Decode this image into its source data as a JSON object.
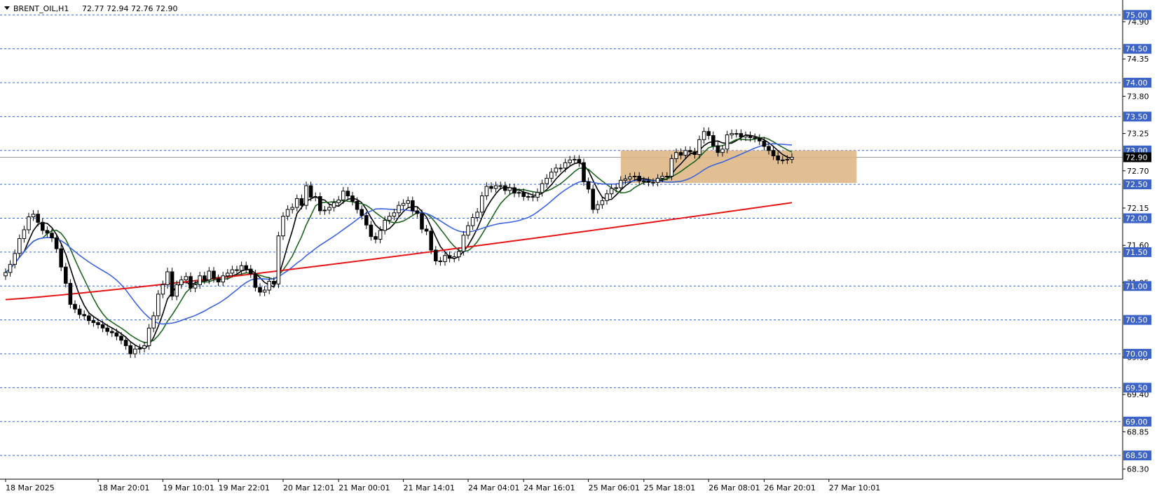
{
  "header": {
    "symbol": "BRENT_OIL,H1",
    "ohlc": "72.77 72.94 72.76 72.90"
  },
  "colors": {
    "background": "#ffffff",
    "level_line": "#3c64c8",
    "level_label_bg": "#3c64c8",
    "zone_fill": "#deb887",
    "ma_black": "#000000",
    "ma_green": "#1e641e",
    "ma_blue": "#3c64dc",
    "ma_red": "#e61414",
    "current_price_bg": "#000000"
  },
  "chart_data": {
    "type": "candlestick",
    "title": "BRENT_OIL,H1",
    "ylim": [
      68.15,
      75.22
    ],
    "y_ticks": [
      {
        "value": 74.9,
        "label": "74.90"
      },
      {
        "value": 74.35,
        "label": "74.35"
      },
      {
        "value": 73.8,
        "label": "73.80"
      },
      {
        "value": 73.25,
        "label": "73.25"
      },
      {
        "value": 72.7,
        "label": "72.70"
      },
      {
        "value": 72.15,
        "label": "72.15"
      },
      {
        "value": 71.6,
        "label": "71.60"
      },
      {
        "value": 71.05,
        "label": "71.05"
      },
      {
        "value": 69.95,
        "label": "69.95"
      },
      {
        "value": 69.4,
        "label": "69.40"
      },
      {
        "value": 68.85,
        "label": "68.85"
      },
      {
        "value": 68.3,
        "label": "68.30"
      }
    ],
    "x_ticks": [
      {
        "bar": 0,
        "label": "18 Mar 2025"
      },
      {
        "bar": 20,
        "label": "18 Mar 20:01"
      },
      {
        "bar": 34,
        "label": "19 Mar 10:01"
      },
      {
        "bar": 46,
        "label": "19 Mar 22:01"
      },
      {
        "bar": 60,
        "label": "20 Mar 12:01"
      },
      {
        "bar": 72,
        "label": "21 Mar 00:01"
      },
      {
        "bar": 86,
        "label": "21 Mar 14:01"
      },
      {
        "bar": 100,
        "label": "24 Mar 04:01"
      },
      {
        "bar": 112,
        "label": "24 Mar 16:01"
      },
      {
        "bar": 126,
        "label": "25 Mar 06:01"
      },
      {
        "bar": 138,
        "label": "25 Mar 18:01"
      },
      {
        "bar": 152,
        "label": "26 Mar 08:01"
      },
      {
        "bar": 164,
        "label": "26 Mar 20:01"
      },
      {
        "bar": 178,
        "label": "27 Mar 10:01"
      }
    ],
    "levels": [
      {
        "value": 75.0,
        "label": "75.00"
      },
      {
        "value": 74.5,
        "label": "74.50"
      },
      {
        "value": 74.0,
        "label": "74.00"
      },
      {
        "value": 73.5,
        "label": "73.50"
      },
      {
        "value": 73.0,
        "label": "73.00"
      },
      {
        "value": 72.5,
        "label": "72.50"
      },
      {
        "value": 72.0,
        "label": "72.00"
      },
      {
        "value": 71.5,
        "label": "71.50"
      },
      {
        "value": 71.0,
        "label": "71.00"
      },
      {
        "value": 70.5,
        "label": "70.50"
      },
      {
        "value": 70.0,
        "label": "70.00"
      },
      {
        "value": 69.5,
        "label": "69.50"
      },
      {
        "value": 69.0,
        "label": "69.00"
      },
      {
        "value": 68.5,
        "label": "68.50"
      }
    ],
    "current_price": {
      "value": 72.9,
      "label": "72.90"
    },
    "zone": {
      "bar_start": 133,
      "bar_end": 184,
      "y_low": 72.52,
      "y_high": 73.0
    },
    "bar_count": 190,
    "candles_close": [
      71.2,
      71.32,
      71.48,
      71.7,
      71.83,
      72.02,
      72.06,
      71.94,
      71.82,
      71.78,
      71.71,
      71.55,
      71.28,
      71.04,
      70.73,
      70.66,
      70.58,
      70.56,
      70.49,
      70.46,
      70.43,
      70.38,
      70.33,
      70.31,
      70.26,
      70.2,
      70.12,
      70.0,
      70.07,
      70.08,
      70.12,
      70.38,
      70.56,
      70.88,
      71.02,
      71.21,
      70.85,
      71.02,
      71.09,
      71.14,
      70.97,
      71.02,
      71.15,
      71.09,
      71.22,
      71.11,
      71.06,
      71.15,
      71.19,
      71.24,
      71.23,
      71.3,
      71.25,
      71.18,
      70.98,
      70.91,
      70.94,
      71.07,
      71.03,
      71.74,
      72.03,
      72.13,
      72.16,
      72.29,
      72.19,
      72.48,
      72.31,
      72.32,
      72.11,
      72.12,
      72.16,
      72.23,
      72.27,
      72.4,
      72.33,
      72.25,
      72.13,
      72.04,
      71.9,
      71.73,
      71.69,
      71.82,
      71.97,
      72.03,
      72.08,
      72.19,
      72.22,
      72.26,
      72.11,
      72.07,
      71.84,
      71.81,
      71.53,
      71.37,
      71.36,
      71.45,
      71.41,
      71.43,
      71.51,
      71.75,
      71.89,
      72.01,
      72.09,
      72.33,
      72.47,
      72.44,
      72.48,
      72.48,
      72.41,
      72.45,
      72.37,
      72.38,
      72.32,
      72.32,
      72.31,
      72.38,
      72.51,
      72.59,
      72.68,
      72.74,
      72.74,
      72.82,
      72.86,
      72.87,
      72.82,
      72.54,
      72.43,
      72.13,
      72.2,
      72.26,
      72.36,
      72.44,
      72.45,
      72.56,
      72.58,
      72.61,
      72.62,
      72.55,
      72.55,
      72.53,
      72.53,
      72.59,
      72.62,
      72.62,
      72.88,
      72.97,
      72.93,
      73.0,
      72.98,
      72.94,
      73.16,
      73.28,
      73.22,
      73.07,
      72.97,
      73.02,
      73.23,
      73.25,
      73.25,
      73.2,
      73.22,
      73.19,
      73.18,
      73.14,
      73.06,
      73.0,
      72.92,
      72.86,
      72.86,
      72.87,
      72.9
    ],
    "moving_averages": [
      {
        "color": "#000000",
        "period_hint": "short",
        "values": []
      },
      {
        "color": "#1e641e",
        "period_hint": "medium",
        "values": []
      },
      {
        "color": "#3c64dc",
        "period_hint": "long",
        "values": []
      },
      {
        "color": "#e61414",
        "period_hint": "very long",
        "values": []
      }
    ],
    "grid": false
  }
}
